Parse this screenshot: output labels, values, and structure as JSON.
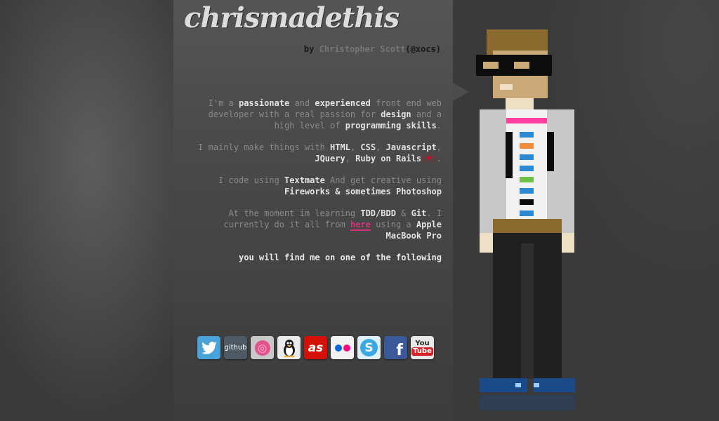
{
  "site": {
    "logo": "chrismadethis",
    "by_label": "by ",
    "author_name": "Christopher Scott",
    "handle": "(@xocs)"
  },
  "bio": {
    "p1": {
      "t1": "I'm a ",
      "b1": "passionate",
      "t2": " and ",
      "b2": "experienced",
      "t3": " front end web developer with a real passion for ",
      "b3": "design",
      "t4": " and a high level of ",
      "b4": "programming skills",
      "t5": "."
    },
    "p2": {
      "t1": "I mainly make things with ",
      "b1": "HTML",
      "t2": ", ",
      "b2": "CSS",
      "t3": ", ",
      "b3": "Javascript",
      "t4": ", ",
      "b4": "JQuery",
      "t5": ", ",
      "b5": "Ruby on Rails",
      "heart": "(♥)",
      "t6": "."
    },
    "p3": {
      "t1": "I code using ",
      "b1": "Textmate",
      "t2": " And get creative using ",
      "b2": "Fireworks & sometimes Photoshop"
    },
    "p4": {
      "t1": "At the moment im learning ",
      "b1": "TDD/BDD",
      "t2": " & ",
      "b2": "Git",
      "t3": ". I currently do it all from ",
      "link": "here",
      "t4": " using a ",
      "b3": "Apple MacBook Pro"
    },
    "follow": "you will find me on one of the following"
  },
  "social": {
    "github_label": "github",
    "dribbble_label": "◎",
    "lastfm_label": "as",
    "skype_label": "S",
    "facebook_label": "f",
    "youtube_you": "You",
    "youtube_tube": "Tube",
    "colors": {
      "twitter": "#4aa3d8",
      "github": "#4d5a64",
      "dribbble": "#c8c8c8",
      "tux": "#eaeaea",
      "lastfm": "#d51007",
      "flickr": "#f2f2f2",
      "skype": "#3ba8e3",
      "facebook": "#3b5998",
      "youtube": "#e8e8e8"
    }
  },
  "colors": {
    "accent_link": "#d6337a",
    "heart": "#b8142c"
  }
}
